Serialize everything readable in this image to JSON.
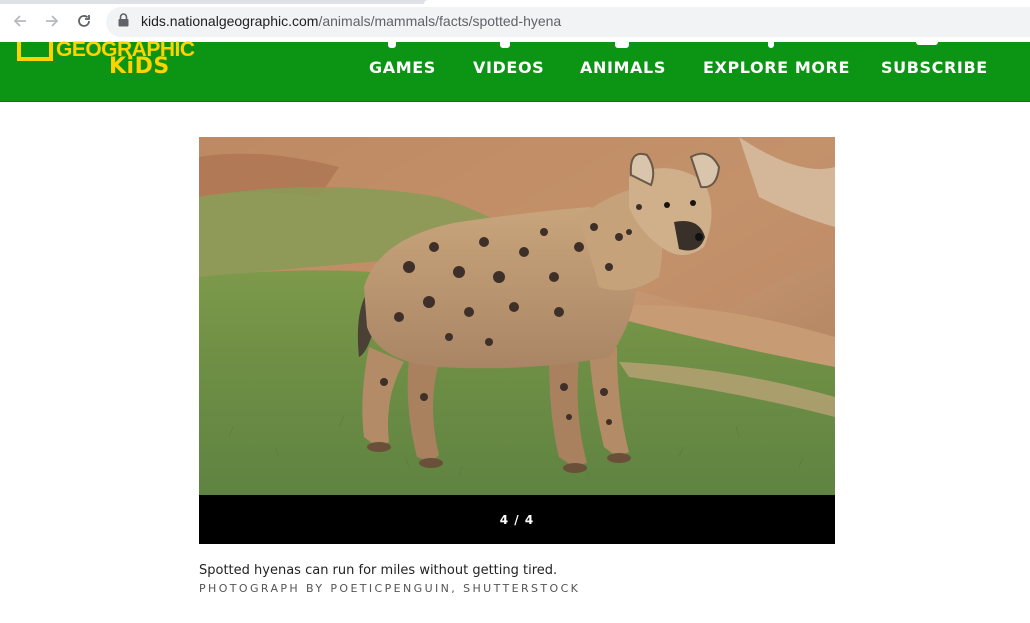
{
  "browser": {
    "url_host": "kids.nationalgeographic.com",
    "url_path": "/animals/mammals/facts/spotted-hyena",
    "icons": [
      "back-arrow-icon",
      "forward-arrow-icon",
      "reload-icon",
      "lock-icon"
    ]
  },
  "header": {
    "logo_geographic": "GEOGRAPHIC",
    "logo_kids": "KiDS",
    "brand_color": "#0c9414",
    "logo_color": "#ffd200",
    "nav": [
      {
        "label": "GAMES"
      },
      {
        "label": "VIDEOS"
      },
      {
        "label": "ANIMALS"
      },
      {
        "label": "EXPLORE MORE"
      },
      {
        "label": "SUBSCRIBE"
      }
    ]
  },
  "gallery": {
    "image_subject": "spotted hyena standing on grass",
    "counter": "4 / 4",
    "caption": "Spotted hyenas can run for miles without getting tired.",
    "credit": "PHOTOGRAPH BY POETICPENGUIN, SHUTTERSTOCK"
  }
}
